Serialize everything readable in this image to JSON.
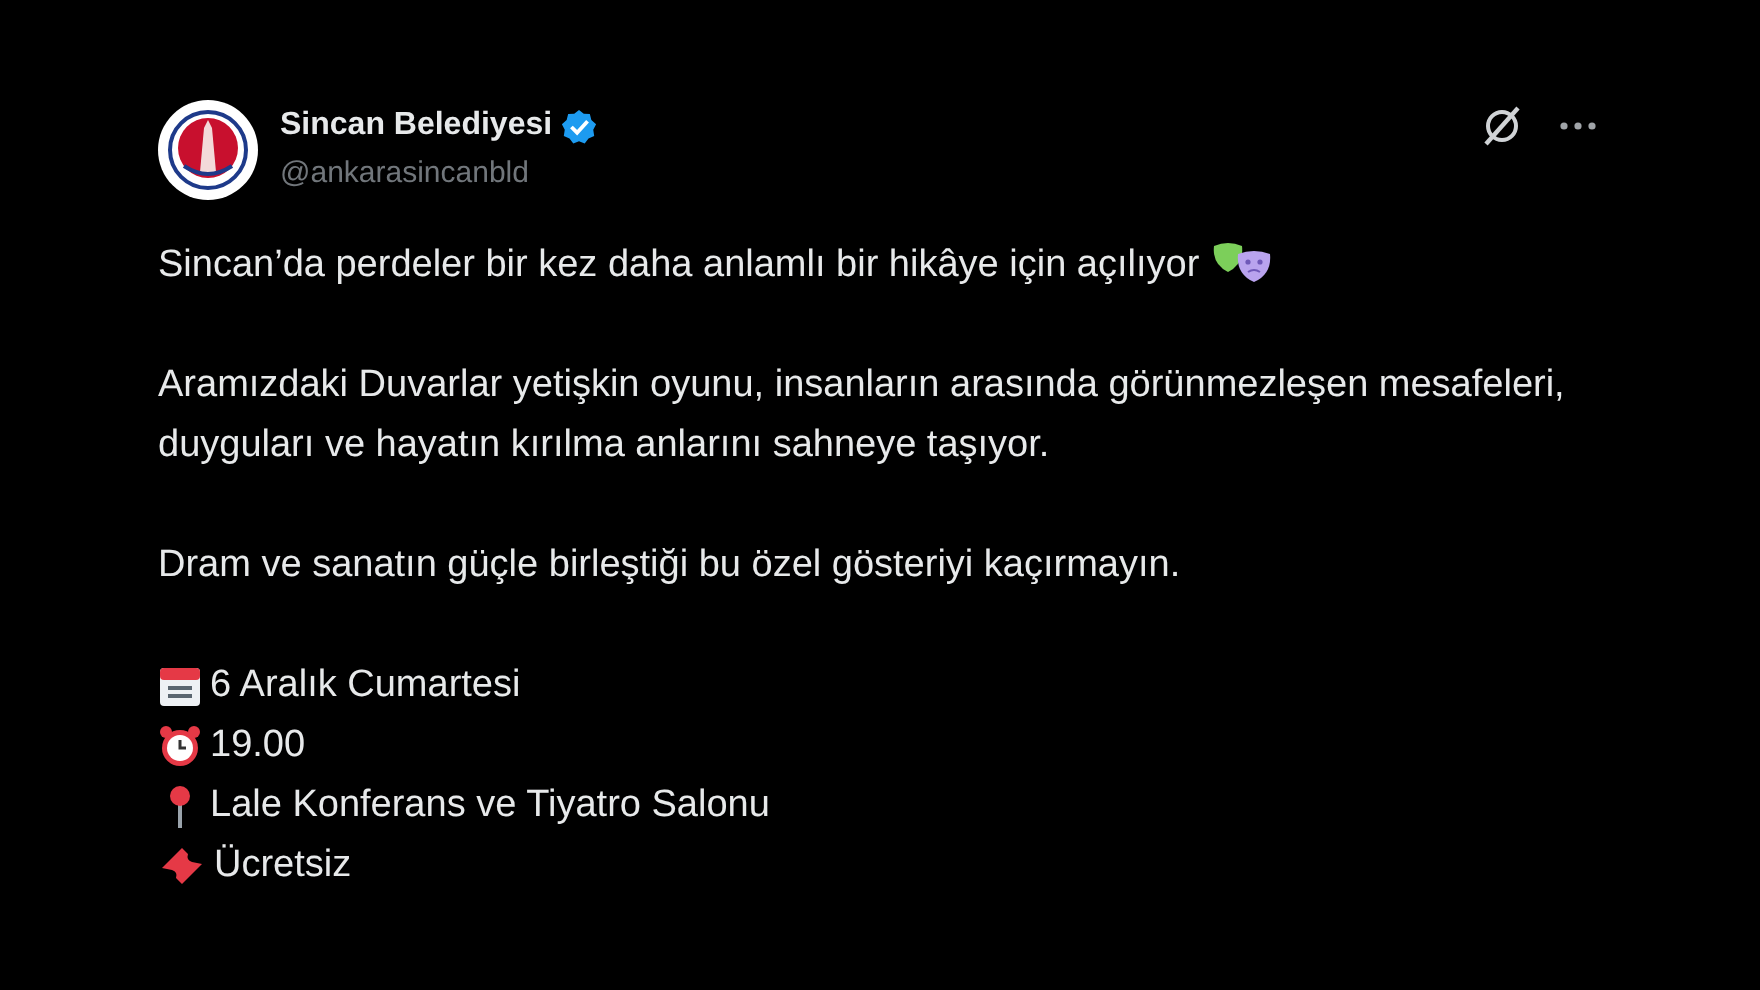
{
  "post": {
    "author": {
      "name": "Sincan Belediyesi",
      "handle": "@ankarasincanbld",
      "verified": true
    },
    "paragraphs": [
      "Sincan’da perdeler bir kez daha anlamlı bir hikâye için açılıyor",
      "Aramızdaki Duvarlar yetişkin oyunu, insanların arasında görünmezleşen mesafeleri, duyguları ve hayatın kırılma anlarını sahneye taşıyor.",
      "Dram ve sanatın güçle birleştiği bu özel gösteriyi kaçırmayın."
    ],
    "details": [
      {
        "kind": "calendar",
        "text": "6 Aralık Cumartesi"
      },
      {
        "kind": "alarm",
        "text": "19.00"
      },
      {
        "kind": "pin",
        "text": "Lale Konferans ve Tiyatro Salonu"
      },
      {
        "kind": "ticket",
        "text": "Ücretsiz"
      }
    ]
  }
}
